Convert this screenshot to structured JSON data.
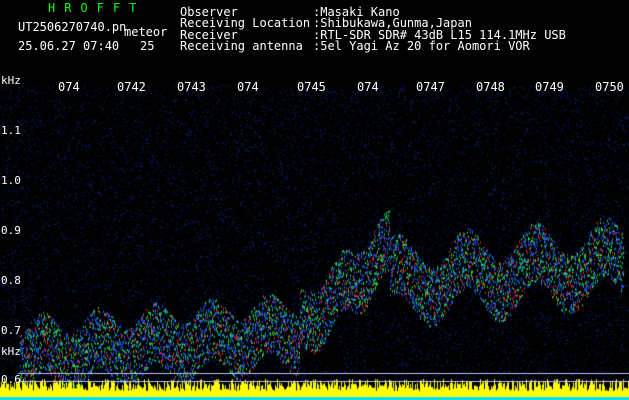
{
  "header": {
    "brand": "HROFFT",
    "file": "UT2506270740.pn",
    "mode": "meteor",
    "timestamp": "25.06.27 07:40",
    "count": "25",
    "fields": [
      {
        "label": "Observer",
        "value": ":Masaki Kano"
      },
      {
        "label": "Receiving Location",
        "value": ":Shibukawa,Gunma,Japan"
      },
      {
        "label": "Receiver",
        "value": ":RTL-SDR SDR# 43dB L15 114.1MHz USB"
      },
      {
        "label": "Receiving antenna",
        "value": ":5el Yagi Az 20 for Aomori VOR"
      }
    ]
  },
  "spectrogram": {
    "unit": "kHz",
    "unit_bottom": "kHz",
    "time_ticks": [
      "074",
      "0742",
      "0743",
      "074",
      "0745",
      "074",
      "0747",
      "0748",
      "0749",
      "0750"
    ],
    "freq_ticks": [
      "1.1",
      "1.0",
      "0.9",
      "0.8",
      "0.7",
      "0.6"
    ],
    "colors": {
      "noise": "#0a1aa0",
      "signal_hi": "#ff2010",
      "signal_mid": "#20e040",
      "band": "#ffff00",
      "band2": "#00e0ff"
    }
  }
}
